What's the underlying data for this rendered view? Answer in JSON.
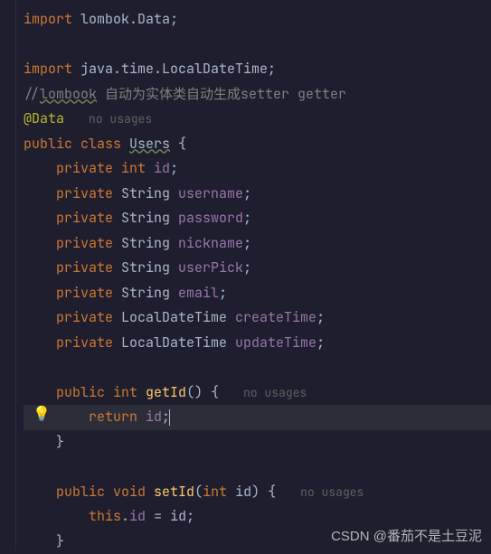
{
  "code": {
    "line1_import": "import",
    "line1_pkg": " lombok",
    "line1_dot": ".",
    "line1_cls": "Data",
    "line1_semi": ";",
    "line3_import": "import",
    "line3_pkg": " java.time.LocalDateTime",
    "line3_semi": ";",
    "line4_slashes": "//",
    "line4_link": "lombook",
    "line4_cn": " 自动为实体类自动生成",
    "line4_sg": "setter getter",
    "line5_anno": "@Data",
    "line5_hint": "no usages",
    "line6_pub": "public",
    "line6_class": " class ",
    "line6_name": "Users",
    "line6_brace": " {",
    "f_private": "private",
    "t_int": " int ",
    "t_String": " String ",
    "t_LDT": " LocalDateTime ",
    "f_id": "id",
    "f_username": "username",
    "f_password": "password",
    "f_nickname": "nickname",
    "f_userPick": "userPick",
    "f_email": "email",
    "f_createTime": "createTime",
    "f_updateTime": "updateTime",
    "semi": ";",
    "m_getId_pub": "public",
    "m_getId_int": " int ",
    "m_getId_name": "getId",
    "m_getId_paren": "() {",
    "m_getId_hint": "no usages",
    "m_return": "return",
    "m_return_id": " id",
    "m_return_semi": ";",
    "brace_close": "}",
    "m_setId_pub": "public",
    "m_setId_void": " void ",
    "m_setId_name": "setId",
    "m_setId_open": "(",
    "m_setId_ptype": "int",
    "m_setId_pname": " id",
    "m_setId_close": ") {",
    "m_setId_hint": "no usages",
    "m_this": "this",
    "m_this_dot": ".",
    "m_this_id": "id",
    "m_assign": " = id;",
    "indent1": "    ",
    "indent2": "        ",
    "sp3": "   "
  },
  "watermark": "CSDN @番茄不是土豆泥",
  "bulb": "💡"
}
